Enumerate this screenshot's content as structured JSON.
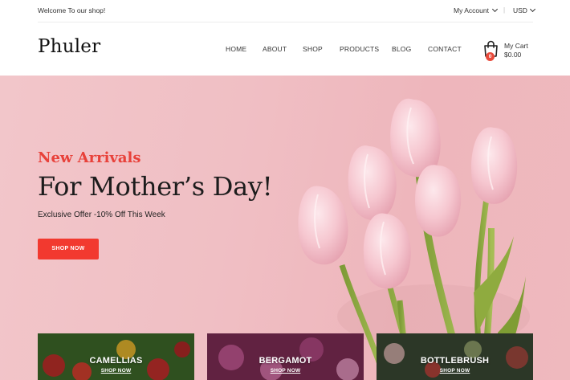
{
  "topbar": {
    "welcome": "Welcome To our shop!",
    "account_label": "My Account",
    "separator": "|",
    "currency": "USD"
  },
  "header": {
    "logo": "Phuler",
    "nav": [
      {
        "label": "HOME"
      },
      {
        "label": "ABOUT"
      },
      {
        "label": "SHOP"
      },
      {
        "label": "PRODUCTS"
      },
      {
        "label": "BLOG"
      },
      {
        "label": "CONTACT"
      }
    ],
    "cart": {
      "label": "My Cart",
      "total": "$0.00",
      "count": "0"
    }
  },
  "hero": {
    "subtitle": "New Arrivals",
    "title": "For Mother’s Day!",
    "offer": "Exclusive Offer -10% Off This Week",
    "button": "SHOP NOW"
  },
  "categories": [
    {
      "name": "CAMELLIAS",
      "link": "SHOP NOW"
    },
    {
      "name": "BERGAMOT",
      "link": "SHOP NOW"
    },
    {
      "name": "BOTTLEBRUSH",
      "link": "SHOP NOW"
    }
  ],
  "colors": {
    "accent": "#f2392f",
    "hero_bg": "#f0bfc4",
    "badge": "#e84a3b"
  }
}
